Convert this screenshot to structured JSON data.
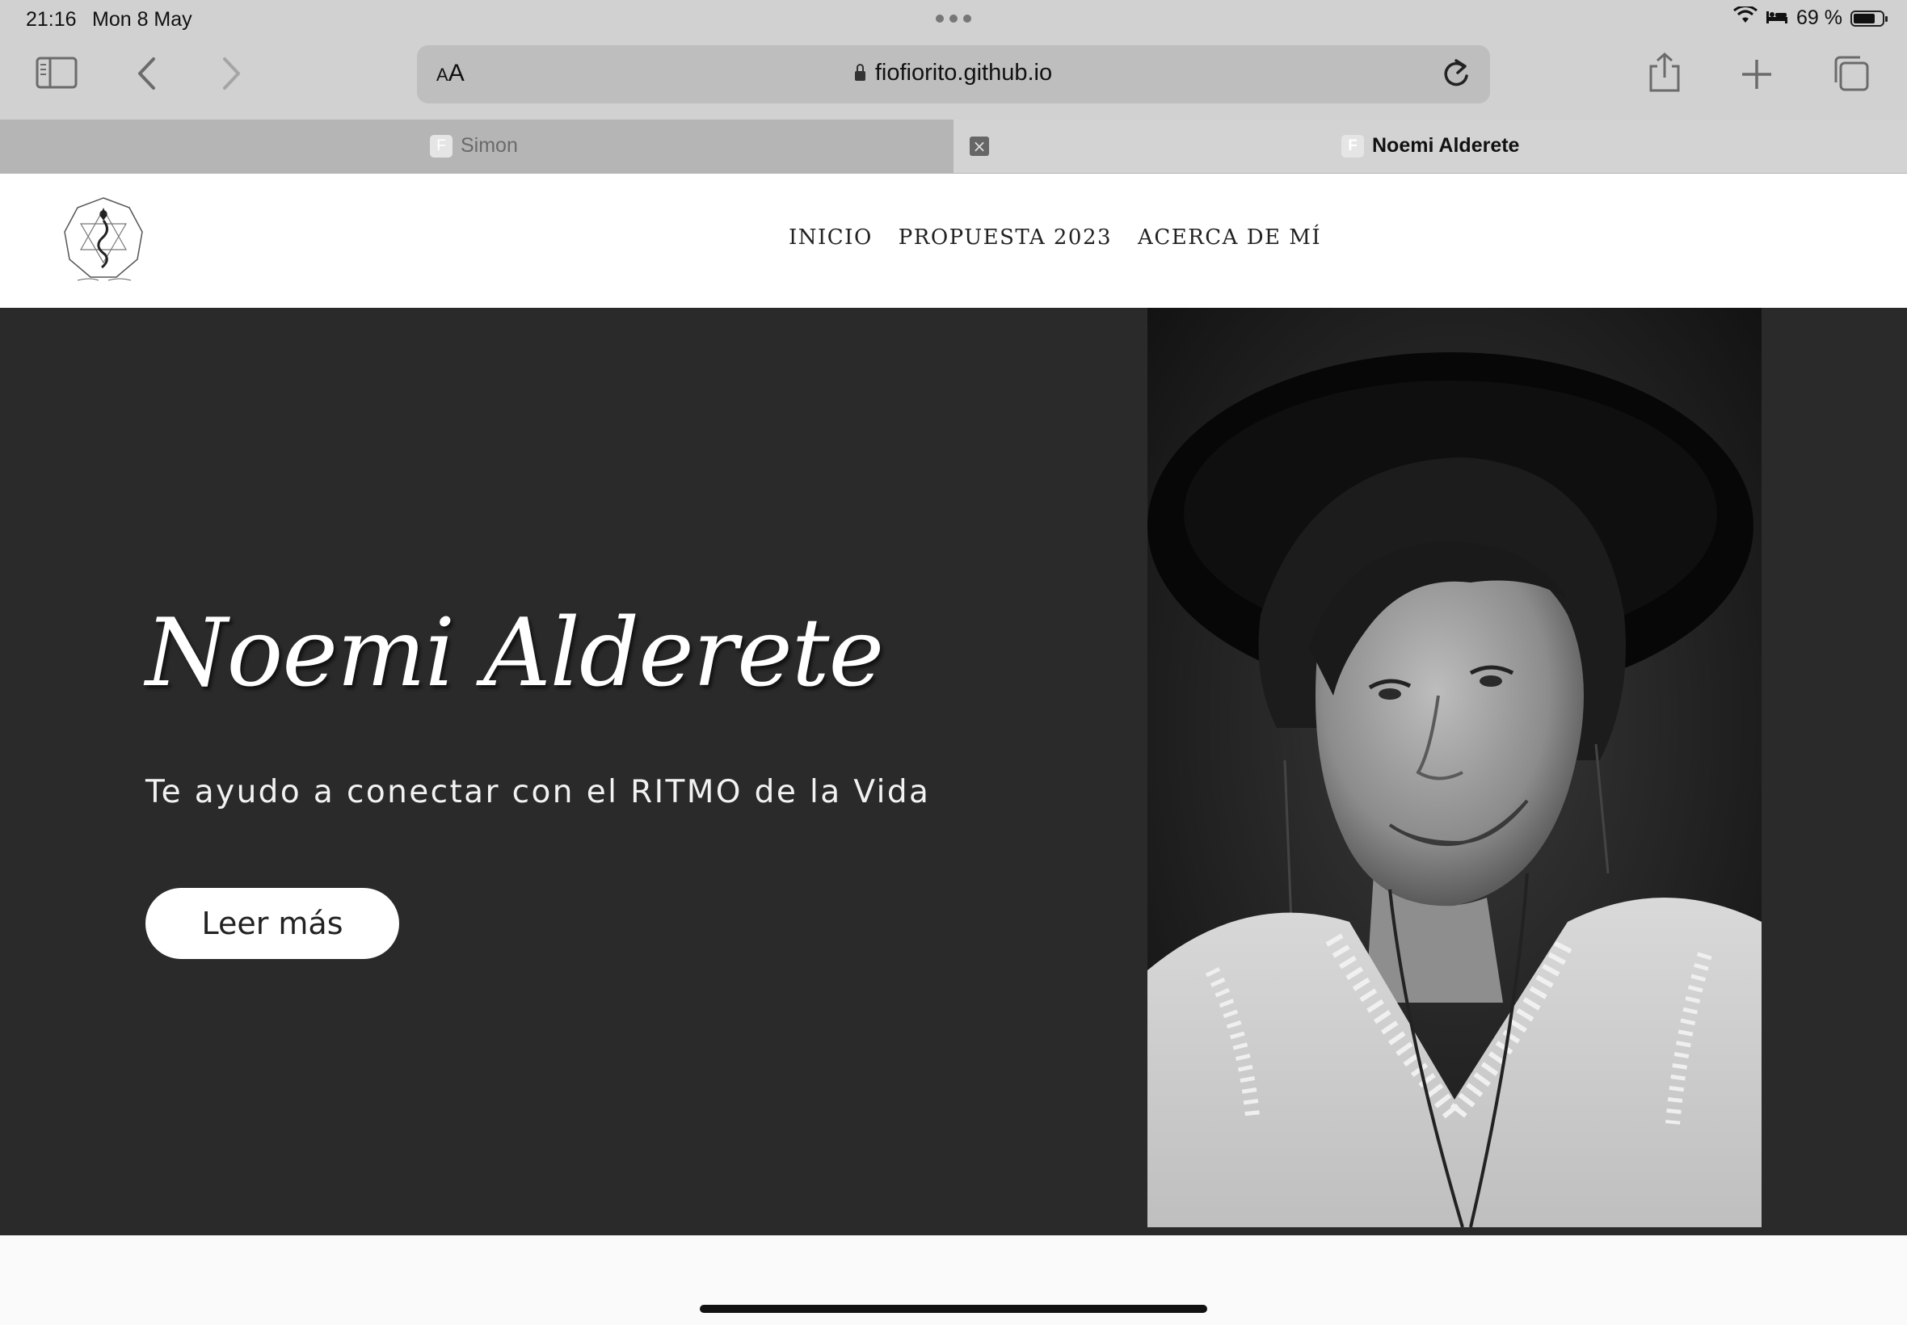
{
  "status_bar": {
    "time": "21:16",
    "date": "Mon 8 May",
    "battery": "69 %",
    "icons": [
      "wifi-icon",
      "bed-icon",
      "battery-icon"
    ]
  },
  "browser": {
    "text_size_label_small": "A",
    "text_size_label_large": "A",
    "url": "fiofiorito.github.io",
    "toolbar_icons": [
      "sidebar-icon",
      "back-icon",
      "forward-icon",
      "reload-icon",
      "share-icon",
      "new-tab-icon",
      "tab-overview-icon"
    ],
    "tabs": [
      {
        "favicon": "F",
        "title": "Simon",
        "active": false
      },
      {
        "favicon": "F",
        "title": "Noemi Alderete",
        "active": true,
        "close": "×"
      }
    ]
  },
  "site": {
    "nav": [
      "INICIO",
      "PROPUESTA 2023",
      "ACERCA DE MÍ"
    ],
    "hero": {
      "title": "Noemi Alderete",
      "subtitle": "Te ayudo a conectar con el RITMO de la Vida",
      "button": "Leer más"
    }
  },
  "colors": {
    "chrome_bg": "#d1d1d1",
    "hero_bg": "#2a2a2a",
    "accent_text": "#ffffff"
  }
}
